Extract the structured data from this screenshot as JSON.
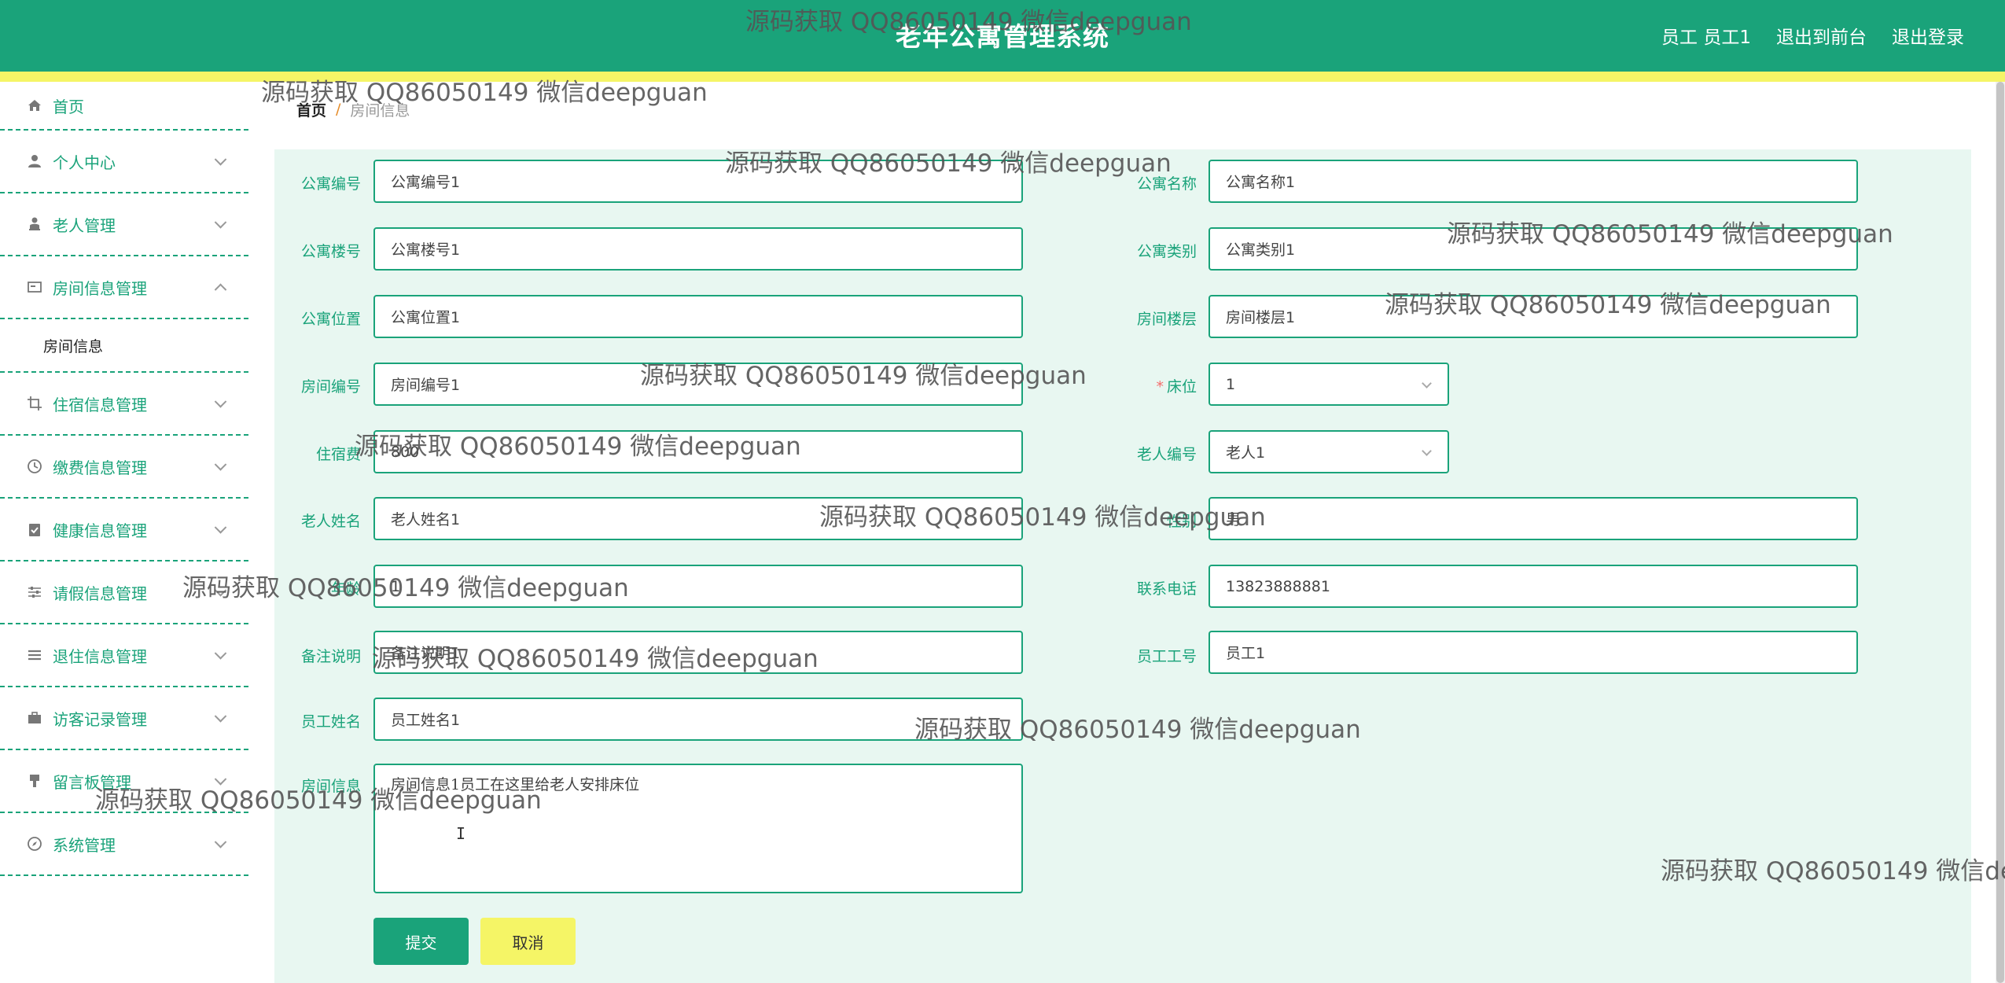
{
  "header": {
    "title": "老年公寓管理系统",
    "user_label": "员工 员工1",
    "back_to_front": "退出到前台",
    "logout": "退出登录"
  },
  "sidebar": {
    "items": [
      {
        "label": "首页",
        "icon": "home-icon"
      },
      {
        "label": "个人中心",
        "icon": "user-icon"
      },
      {
        "label": "老人管理",
        "icon": "elder-icon"
      },
      {
        "label": "房间信息管理",
        "icon": "room-icon"
      },
      {
        "label": "住宿信息管理",
        "icon": "crop-icon"
      },
      {
        "label": "缴费信息管理",
        "icon": "clock-icon"
      },
      {
        "label": "健康信息管理",
        "icon": "clipboard-check-icon"
      },
      {
        "label": "请假信息管理",
        "icon": "sliders-icon"
      },
      {
        "label": "退住信息管理",
        "icon": "list-icon"
      },
      {
        "label": "访客记录管理",
        "icon": "briefcase-icon"
      },
      {
        "label": "留言板管理",
        "icon": "brush-icon"
      },
      {
        "label": "系统管理",
        "icon": "compass-icon"
      }
    ],
    "submenu_room": "房间信息"
  },
  "breadcrumb": {
    "home": "首页",
    "separator": "/",
    "current": "房间信息"
  },
  "form": {
    "apartment_no": {
      "label": "公寓编号",
      "value": "公寓编号1"
    },
    "apartment_name": {
      "label": "公寓名称",
      "value": "公寓名称1"
    },
    "building_no": {
      "label": "公寓楼号",
      "value": "公寓楼号1"
    },
    "apartment_type": {
      "label": "公寓类别",
      "value": "公寓类别1"
    },
    "location": {
      "label": "公寓位置",
      "value": "公寓位置1"
    },
    "floor": {
      "label": "房间楼层",
      "value": "房间楼层1"
    },
    "room_no": {
      "label": "房间编号",
      "value": "房间编号1"
    },
    "bed": {
      "required_mark": "*",
      "label": "床位",
      "value": "1"
    },
    "fee": {
      "label": "住宿费",
      "value": "800"
    },
    "elder_no": {
      "label": "老人编号",
      "value": "老人1"
    },
    "elder_name": {
      "label": "老人姓名",
      "value": "老人姓名1"
    },
    "gender": {
      "label": "性别",
      "value": "男"
    },
    "age": {
      "label": "年龄",
      "value": "1"
    },
    "phone": {
      "label": "联系电话",
      "value": "13823888881"
    },
    "remark": {
      "label": "备注说明",
      "value": "备注说明1"
    },
    "staff_no": {
      "label": "员工工号",
      "value": "员工1"
    },
    "staff_name": {
      "label": "员工姓名",
      "value": "员工姓名1"
    },
    "room_info": {
      "label": "房间信息",
      "value": "房间信息1员工在这里给老人安排床位"
    },
    "submit_label": "提交",
    "cancel_label": "取消"
  },
  "watermark_text": "源码获取 QQ86050149 微信deepguan",
  "colors": {
    "primary": "#1aa37a",
    "accent_yellow": "#f5f566",
    "panel_bg": "#e8f7f1",
    "required": "#f56c6c"
  }
}
